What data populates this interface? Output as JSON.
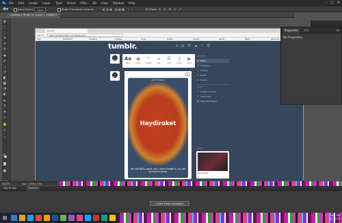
{
  "menubar": {
    "app_logo": "Ps",
    "items": [
      "File",
      "Edit",
      "Image",
      "Layer",
      "Type",
      "Select",
      "Filter",
      "3D",
      "View",
      "Window",
      "Help"
    ],
    "window_controls": [
      "–",
      "□",
      "✕"
    ]
  },
  "options": {
    "auto_select_label": "Auto-Select:",
    "auto_select_value": "Layer",
    "show_transform_label": "Show Transform Controls",
    "mode_3d_label": "3D Mode:"
  },
  "document": {
    "tab_title": "Untitled-1 @ 66.7% (Layer 1, RGB/8) *"
  },
  "browser": {
    "tab_title": "tumblr",
    "url": "https://www.tumblr.com/dashboard",
    "bookmarks": [
      "Apps",
      "Dashboard",
      "Facebook",
      "YouTube",
      "Gmail",
      "Twitter",
      "Amazon",
      "Reddit",
      "Netflix",
      "Wikipedia"
    ]
  },
  "tumblr": {
    "logo": "tumblr.",
    "post_types": [
      {
        "glyph": "Aa",
        "label": "Text",
        "color": "#444444"
      },
      {
        "glyph": "◉",
        "label": "Photo",
        "color": "#d95e40"
      },
      {
        "glyph": "❝",
        "label": "Quote",
        "color": "#f2992e"
      },
      {
        "glyph": "∞",
        "label": "Link",
        "color": "#56bc8a"
      },
      {
        "glyph": "☰",
        "label": "Chat",
        "color": "#529ecc"
      },
      {
        "glyph": "♫",
        "label": "Audio",
        "color": "#a77dc2"
      },
      {
        "glyph": "▶",
        "label": "Video",
        "color": "#748089"
      }
    ],
    "post": {
      "series_label": "ARTIST SERIES",
      "title": "Haydiroket",
      "caption": "You did REAL good, kid! I won't forget it. Go get yourself a pizza."
    },
    "sidebar": {
      "header": "ACCOUNT",
      "items": [
        "Posts",
        "Followers",
        "Activity",
        "Drafts",
        "Queue"
      ],
      "active_index": 0,
      "section2": "TOOLS",
      "items2": [
        "Create a group",
        "Customize",
        "Mass Post Editor"
      ],
      "radar_label": "RADAR",
      "radar_caption": "Haydiroket"
    }
  },
  "properties": {
    "tab_active": "Properties",
    "tab_inactive": "Info",
    "content": "No Properties"
  },
  "status": {
    "zoom": "66.67%",
    "doc_info": "Doc: 1.37M/1.37M"
  },
  "timeline": {
    "tabs": [
      "Mini Bridge",
      "Timeline"
    ],
    "create_button": "Create Frame Animation"
  },
  "taskbar": {
    "start": "⊞",
    "time": "3:04 PM",
    "date": "1/1/2015"
  }
}
